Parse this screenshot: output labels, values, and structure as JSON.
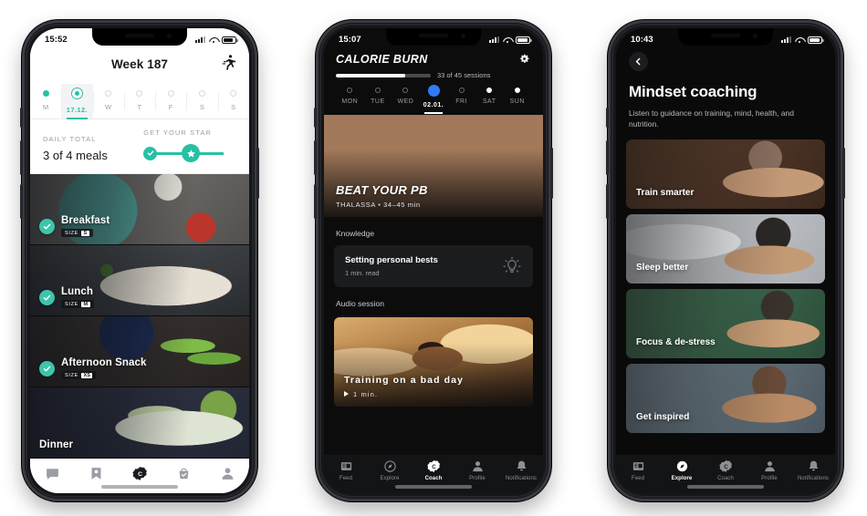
{
  "phones": [
    {
      "id": "meal-plan",
      "theme": "light",
      "status": {
        "time": "15:52"
      },
      "header": {
        "title": "Week 187",
        "action_icon": "runner-icon"
      },
      "days": [
        {
          "label": "M",
          "state": "done"
        },
        {
          "label": "17.12.",
          "state": "active"
        },
        {
          "label": "W",
          "state": "empty"
        },
        {
          "label": "T",
          "state": "empty"
        },
        {
          "label": "F",
          "state": "empty"
        },
        {
          "label": "S",
          "state": "empty"
        },
        {
          "label": "S",
          "state": "empty"
        }
      ],
      "daily_total": {
        "caption": "DAILY TOTAL",
        "value": "3 of 4 meals"
      },
      "star": {
        "caption": "GET YOUR STAR",
        "check_icon": "check-icon",
        "star_icon": "star-icon"
      },
      "meals": [
        {
          "name": "Breakfast",
          "size_key": "SIZE",
          "size_value": "S",
          "checked": true,
          "photo": "ph-breakfast"
        },
        {
          "name": "Lunch",
          "size_key": "SIZE",
          "size_value": "M",
          "checked": true,
          "photo": "ph-lunch"
        },
        {
          "name": "Afternoon Snack",
          "size_key": "SIZE",
          "size_value": "XS",
          "checked": true,
          "photo": "ph-snack"
        },
        {
          "name": "Dinner",
          "size_key": "",
          "size_value": "",
          "checked": false,
          "photo": "ph-dinner"
        }
      ],
      "tabs": [
        {
          "icon": "chat-icon",
          "active": false
        },
        {
          "icon": "bookmark-icon",
          "active": false
        },
        {
          "icon": "coach-icon",
          "active": true
        },
        {
          "icon": "basket-check-icon",
          "active": false
        },
        {
          "icon": "person-icon",
          "active": false
        }
      ]
    },
    {
      "id": "calorie-burn",
      "theme": "dark",
      "status": {
        "time": "15:07"
      },
      "header": {
        "title": "CALORIE BURN",
        "settings_icon": "gear-icon",
        "sessions_text": "33 of 45 sessions",
        "progress_percent": 73
      },
      "days": [
        {
          "label": "MON",
          "state": "ring"
        },
        {
          "label": "TUE",
          "state": "ring"
        },
        {
          "label": "WED",
          "state": "ring"
        },
        {
          "label": "02.01.",
          "state": "today"
        },
        {
          "label": "FRI",
          "state": "ring"
        },
        {
          "label": "SAT",
          "state": "filled"
        },
        {
          "label": "SUN",
          "state": "filled"
        }
      ],
      "hero": {
        "title": "BEAT YOUR PB",
        "meta": "THALASSA  •  34–45 min"
      },
      "sections": [
        {
          "label": "Knowledge"
        },
        {
          "label": "Audio session"
        }
      ],
      "knowledge_card": {
        "title": "Setting personal bests",
        "subtitle": "1 min. read",
        "icon": "lightbulb-icon"
      },
      "audio_card": {
        "title": "Training on a bad day",
        "duration": "1 min.",
        "play_icon": "play-icon"
      },
      "tabs": [
        {
          "label": "Feed",
          "icon": "feed-icon",
          "active": false
        },
        {
          "label": "Explore",
          "icon": "compass-icon",
          "active": false
        },
        {
          "label": "Coach",
          "icon": "coach-icon",
          "active": true
        },
        {
          "label": "Profile",
          "icon": "person-icon",
          "active": false
        },
        {
          "label": "Notifications",
          "icon": "bell-icon",
          "active": false
        }
      ]
    },
    {
      "id": "mindset-coaching",
      "theme": "dark",
      "status": {
        "time": "10:43"
      },
      "header": {
        "back_icon": "chevron-left-icon",
        "title": "Mindset coaching",
        "subtitle": "Listen to guidance on training, mind, health, and nutrition."
      },
      "cards": [
        {
          "label": "Train smarter",
          "photo": "ph-train"
        },
        {
          "label": "Sleep better",
          "photo": "ph-sleep"
        },
        {
          "label": "Focus & de-stress",
          "photo": "ph-focus"
        },
        {
          "label": "Get inspired",
          "photo": "ph-inspire"
        }
      ],
      "tabs": [
        {
          "label": "Feed",
          "icon": "feed-icon",
          "active": false
        },
        {
          "label": "Explore",
          "icon": "compass-icon",
          "active": true
        },
        {
          "label": "Coach",
          "icon": "coach-icon",
          "active": false
        },
        {
          "label": "Profile",
          "icon": "person-icon",
          "active": false
        },
        {
          "label": "Notifications",
          "icon": "bell-icon",
          "active": false
        }
      ]
    }
  ],
  "colors": {
    "accent_teal": "#26c1a4",
    "accent_blue": "#2f7bf6",
    "dark_bg": "#0c0c0d",
    "light_bg": "#ffffff"
  }
}
